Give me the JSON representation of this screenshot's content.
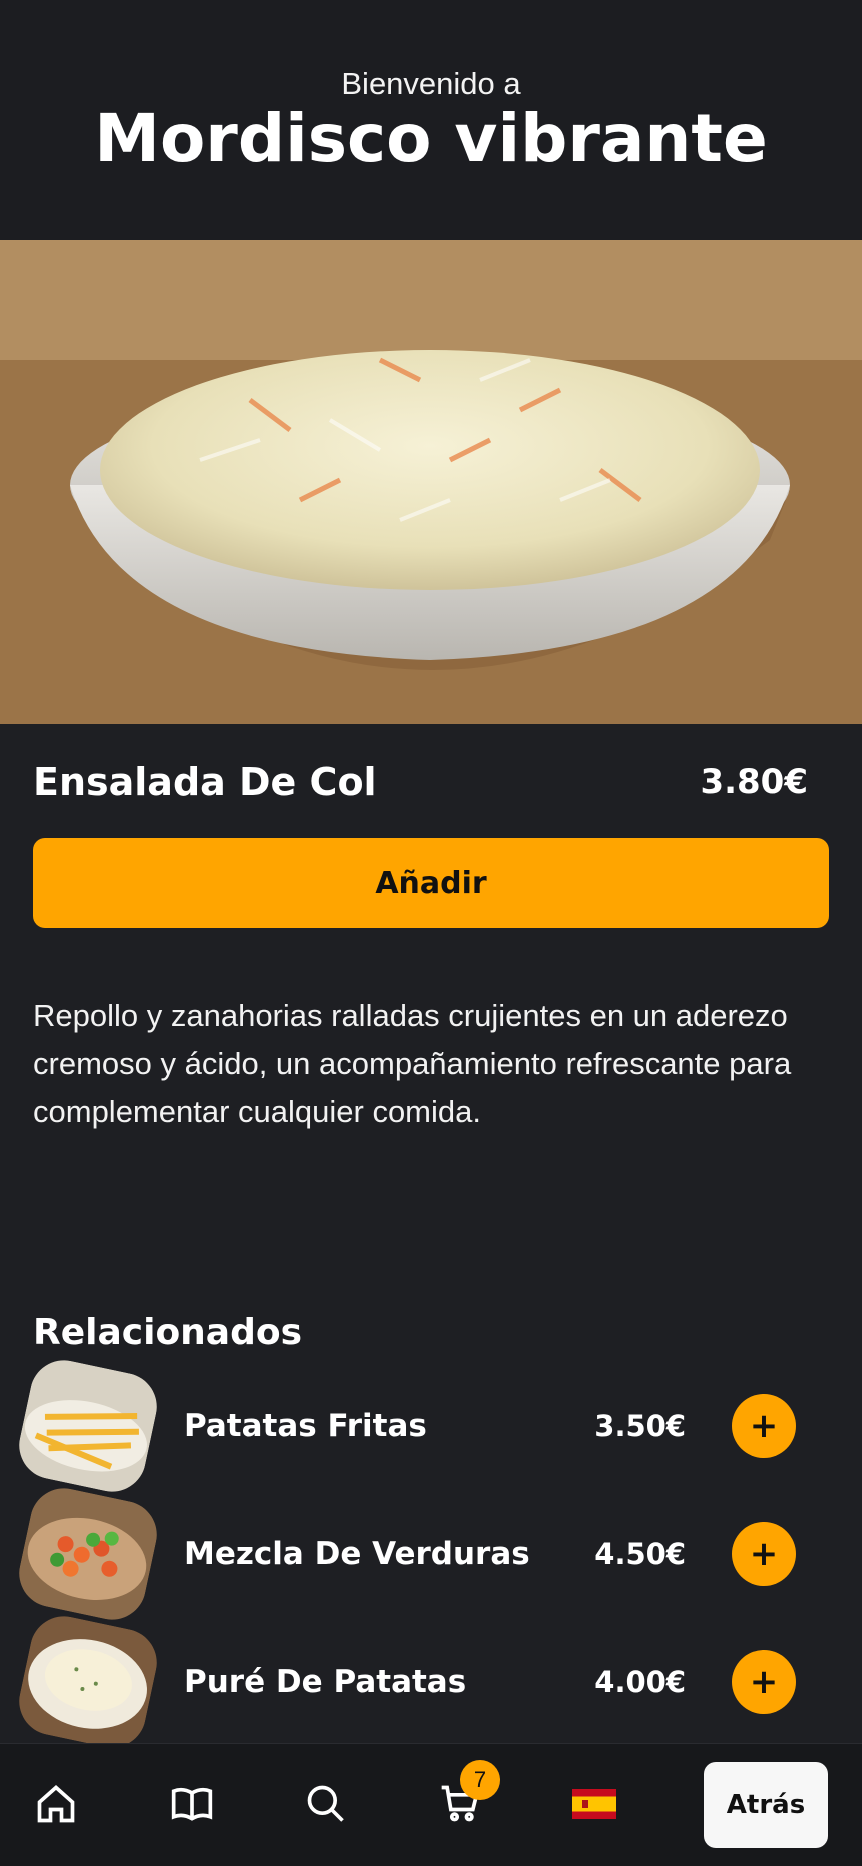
{
  "header": {
    "welcome": "Bienvenido a",
    "brand": "Mordisco vibrante"
  },
  "product": {
    "title": "Ensalada De Col",
    "price": "3.80€",
    "add_label": "Añadir",
    "description": "Repollo y zanahorias ralladas crujientes en un aderezo cremoso y ácido, un acompañamiento refrescante para complementar cualquier comida."
  },
  "related": {
    "title": "Relacionados",
    "items": [
      {
        "name": "Patatas Fritas",
        "price": "3.50€",
        "add_label": "+"
      },
      {
        "name": "Mezcla De Verduras",
        "price": "4.50€",
        "add_label": "+"
      },
      {
        "name": "Puré De Patatas",
        "price": "4.00€",
        "add_label": "+"
      }
    ]
  },
  "nav": {
    "cart_count": "7",
    "back_label": "Atrás",
    "icons": [
      "home-icon",
      "menu-book-icon",
      "search-icon",
      "cart-icon",
      "spain-flag-icon"
    ]
  },
  "colors": {
    "background": "#1e1f23",
    "accent": "#ffa500",
    "text": "#ffffff"
  }
}
